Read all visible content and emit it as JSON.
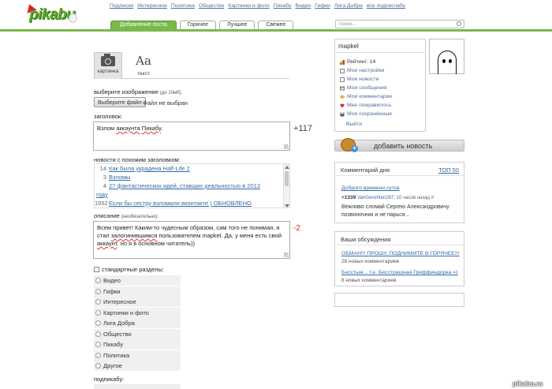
{
  "logo": "pikabu",
  "topnav": [
    "Подписки",
    "Интересное",
    "Политика",
    "Общество",
    "Картинки и фото",
    "Пикабу",
    "Видео",
    "Гифки",
    "Лига Добра",
    "все подписчабу"
  ],
  "search": {
    "placeholder": "поиск..."
  },
  "tabs": [
    "Добавление поста",
    "Горячее",
    "Лучшее",
    "Свежее"
  ],
  "editor": {
    "type_picture": "картинка",
    "type_text_glyph": "Aa",
    "type_text": "текст",
    "image_label": "выберите изображение",
    "image_limit": "(до 10мб):",
    "file_button": "Выберите файл",
    "file_status": "Файл не выбран",
    "title_label": "заголовок:",
    "title_value": {
      "a": "Взлом ",
      "b": "аккаунта",
      "c": " ",
      "d": "Пикабу",
      "e": "."
    },
    "title_counter": "+117",
    "similar_label": "новости с похожим заголовком:",
    "similar": [
      {
        "num": "14",
        "title": "Как была украдена Half-Life 2"
      },
      {
        "num": "3",
        "title": "Взломы"
      },
      {
        "num": "4",
        "title": "27 фантастических идей, ставших реальностью в 2012"
      },
      {
        "num": "",
        "title": "году"
      },
      {
        "num": "1952",
        "title": "Если бы сестру взломали вконтакте ) ОБНОВЛЕНО"
      }
    ],
    "desc_label": "описание",
    "desc_optional": "(необязательно):",
    "desc_value": {
      "a": "Всем привет! Каким-то чудесным образом, сам того не понимая, я стал ",
      "b": "залогинившимся",
      "c": " пользователем mapkel. Да, у меня есть свой ",
      "d": "аккаунт",
      "e": ", но я в основном читатель))"
    },
    "desc_counter": "-2",
    "std_sections_label": "стандартные разделы:",
    "sections": [
      "Видео",
      "Гифки",
      "Интересное",
      "Картинки и фото",
      "Лига Добра",
      "Общество",
      "Пикабу",
      "Политика",
      "Другое"
    ],
    "subscribe_label": "подпикабу:"
  },
  "user": {
    "name": "mapkel",
    "rating": "Рейтинг: 14",
    "menu": [
      "Мои настройки",
      "Мои новости",
      "Мои сообщения",
      "Мои комментарии",
      "Мне понравилось",
      "Мои сохранённые"
    ],
    "logout": "Выйти"
  },
  "add_news": "добавить новость",
  "comment_day": {
    "title": "Комментарий дня",
    "top50": "ТОП 50",
    "link": "Доброго времени суток",
    "score": "+1339",
    "author": "VanGenchten287",
    "time": "; 10 часов назад",
    "hash": "#",
    "text": "Вежливо сломай Сергею Александровичу позвоночник и не парься..."
  },
  "discussions": {
    "title": "Ваши обсуждения",
    "items": [
      {
        "link": "ОБМАН!!! ПРОШУ, ПОДНИМИТЕ В ГОРЯЧЕЕ!!!",
        "sub": "28 новых комментариев"
      },
      {
        "link": "Бесстыж... т.е. Бесстрашная Гриффиндорка =)",
        "sub": "8 новых комментариев"
      }
    ]
  },
  "watermark": "pikabu.ru",
  "colors": {
    "green": "#78b94c",
    "link": "#356aa6",
    "nav": "#506f9a",
    "red": "#d22222"
  }
}
